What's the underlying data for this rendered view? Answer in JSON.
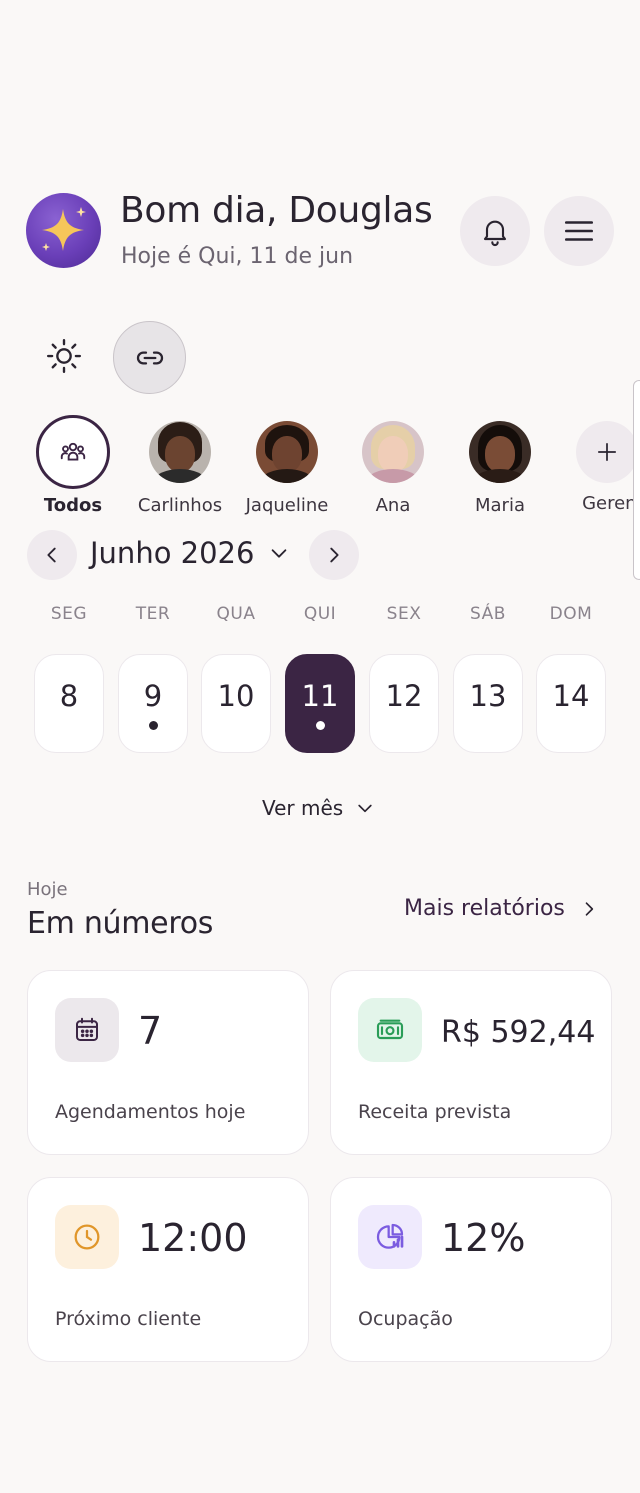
{
  "header": {
    "greeting": "Bom dia, Douglas",
    "date_line": "Hoje é Qui, 11 de jun",
    "logo_icon": "sparkle-icon",
    "notifications_icon": "bell-icon",
    "menu_icon": "hamburger-menu-icon"
  },
  "toolbar": {
    "theme_icon": "sun-icon",
    "link_icon": "link-icon"
  },
  "staff": [
    {
      "name": "Todos",
      "selected": true,
      "icon": "users-group-icon"
    },
    {
      "name": "Carlinhos"
    },
    {
      "name": "Jaqueline"
    },
    {
      "name": "Ana"
    },
    {
      "name": "Maria"
    },
    {
      "name": "Gerenciar",
      "icon": "plus-icon"
    }
  ],
  "calendar": {
    "month_label": "Junho 2026",
    "weekdays": [
      "SEG",
      "TER",
      "QUA",
      "QUI",
      "SEX",
      "SÁB",
      "DOM"
    ],
    "days": [
      {
        "num": "8",
        "dot": false,
        "selected": false
      },
      {
        "num": "9",
        "dot": true,
        "selected": false
      },
      {
        "num": "10",
        "dot": false,
        "selected": false
      },
      {
        "num": "11",
        "dot": true,
        "selected": true
      },
      {
        "num": "12",
        "dot": false,
        "selected": false
      },
      {
        "num": "13",
        "dot": false,
        "selected": false
      },
      {
        "num": "14",
        "dot": false,
        "selected": false
      }
    ],
    "see_month": "Ver mês"
  },
  "numbers": {
    "eyebrow": "Hoje",
    "title": "Em números",
    "more_reports": "Mais relatórios",
    "cards": [
      {
        "value": "7",
        "label": "Agendamentos hoje",
        "icon": "calendar-icon",
        "icon_bg": "#ece8ec",
        "icon_color": "#3b2544"
      },
      {
        "value": "R$ 592,44",
        "label": "Receita prevista",
        "icon": "cash-icon",
        "icon_bg": "#e3f5ea",
        "icon_color": "#2a9d58"
      },
      {
        "value": "12:00",
        "label": "Próximo cliente",
        "icon": "clock-icon",
        "icon_bg": "#fdf0dd",
        "icon_color": "#e0962a"
      },
      {
        "value": "12%",
        "label": "Ocupação",
        "icon": "pie-chart-icon",
        "icon_bg": "#efeafd",
        "icon_color": "#7b5ce0"
      }
    ]
  },
  "colors": {
    "accent": "#3b2544",
    "background": "#faf8f7"
  }
}
